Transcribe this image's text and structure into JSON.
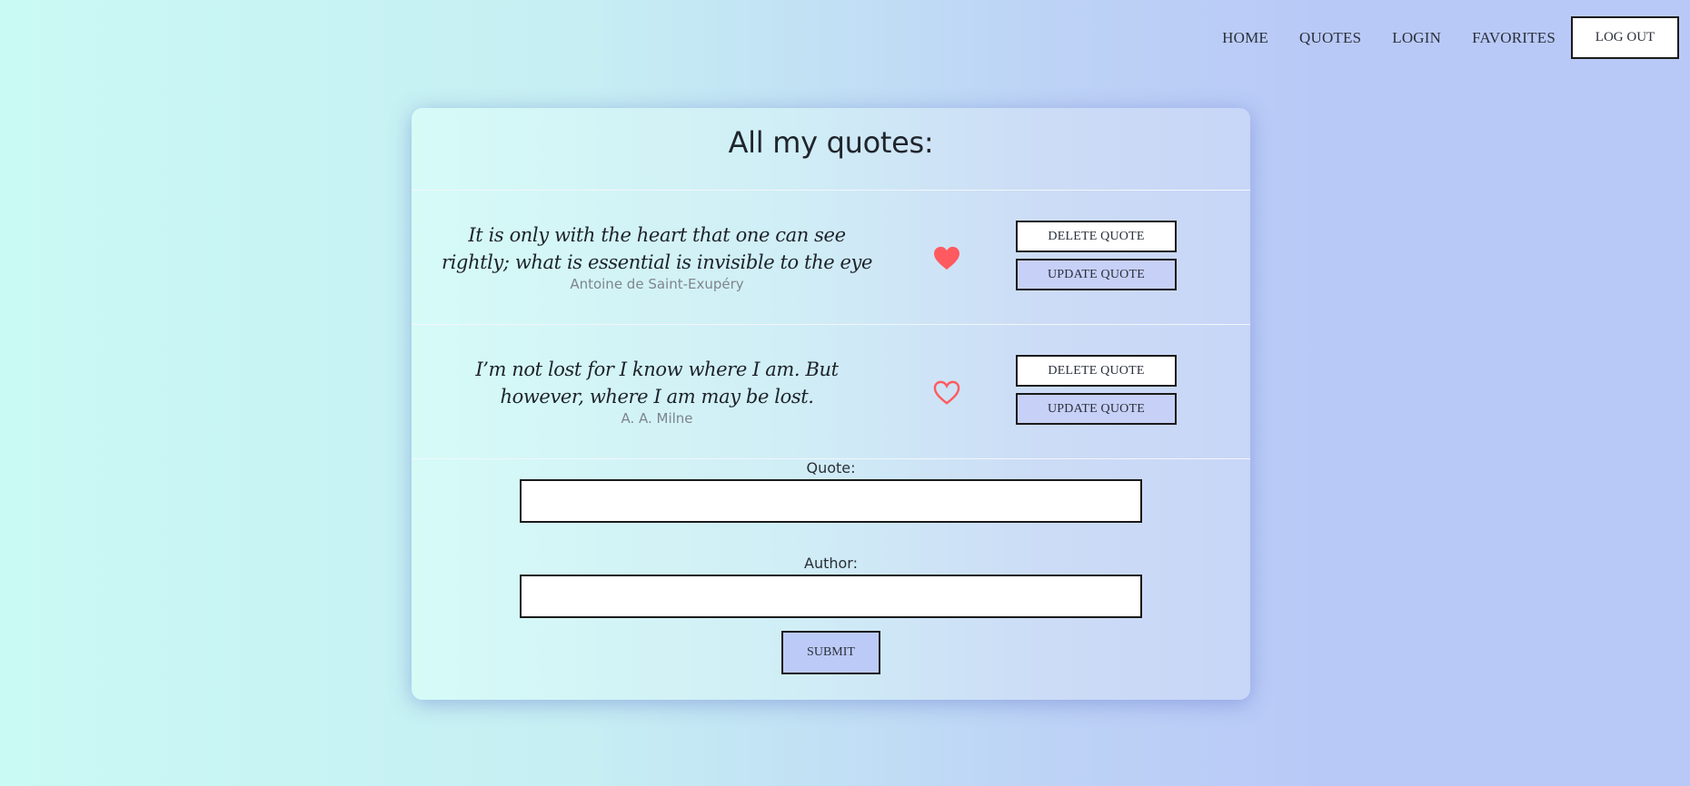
{
  "nav": {
    "home": "HOME",
    "quotes": "QUOTES",
    "login": "LOGIN",
    "favorites": "FAVORITES",
    "logout": "LOG OUT"
  },
  "page": {
    "title": "All my quotes:"
  },
  "quotes": [
    {
      "text": "It is only with the heart that one can see rightly; what is essential is invisible to the eye",
      "author": "Antoine de Saint-Exupéry",
      "favorite": true,
      "delete_label": "DELETE QUOTE",
      "update_label": "UPDATE QUOTE"
    },
    {
      "text": "I’m not lost for I know where I am. But however, where I am may be lost.",
      "author": "A. A. Milne",
      "favorite": false,
      "delete_label": "DELETE QUOTE",
      "update_label": "UPDATE QUOTE"
    }
  ],
  "form": {
    "quote_label": "Quote:",
    "quote_value": "",
    "author_label": "Author:",
    "author_value": "",
    "submit_label": "SUBMIT"
  },
  "colors": {
    "heart": "#ff5a5f",
    "update_button": "#c7d0f6",
    "submit_button": "#bccaf7"
  },
  "icons": {
    "favorite_filled": "heart-filled-icon",
    "favorite_outline": "heart-outline-icon"
  }
}
